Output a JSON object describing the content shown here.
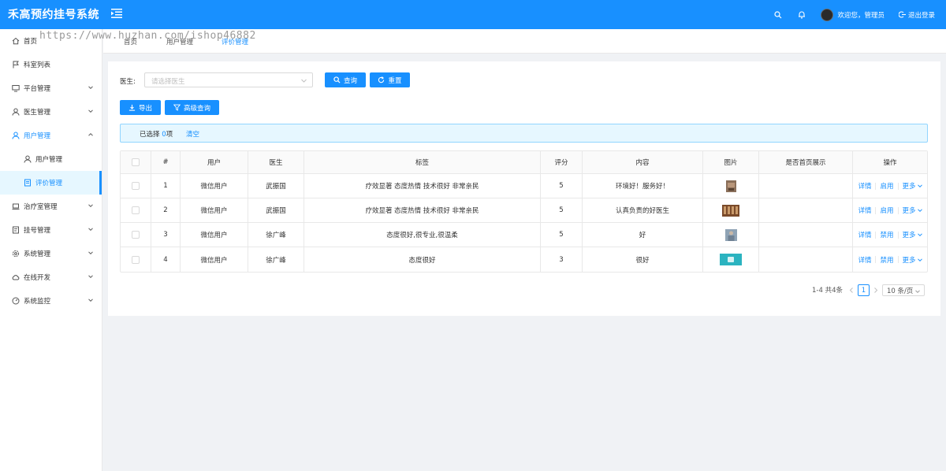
{
  "header": {
    "app_title": "禾高预约挂号系统",
    "welcome": "欢迎您，管理员",
    "logout": "退出登录"
  },
  "watermark": "https://www.huzhan.com/ishop46882",
  "sidebar": {
    "items": [
      {
        "label": "首页",
        "icon": "home-icon"
      },
      {
        "label": "科室列表",
        "icon": "flag-icon"
      },
      {
        "label": "平台管理",
        "icon": "monitor-icon"
      },
      {
        "label": "医生管理",
        "icon": "user-icon"
      },
      {
        "label": "用户管理",
        "icon": "user-icon"
      },
      {
        "label": "用户管理",
        "icon": "user-icon"
      },
      {
        "label": "评价管理",
        "icon": "document-icon"
      },
      {
        "label": "治疗室管理",
        "icon": "laptop-icon"
      },
      {
        "label": "挂号管理",
        "icon": "list-icon"
      },
      {
        "label": "系统管理",
        "icon": "gear-icon"
      },
      {
        "label": "在线开发",
        "icon": "cloud-icon"
      },
      {
        "label": "系统监控",
        "icon": "dashboard-icon"
      }
    ]
  },
  "tabs": [
    "首页",
    "用户管理",
    "评价管理"
  ],
  "filter": {
    "doctor_label": "医生:",
    "doctor_placeholder": "请选择医生",
    "query": "查询",
    "reset": "重置"
  },
  "toolbar": {
    "export": "导出",
    "advanced": "高级查询"
  },
  "selection": {
    "prefix": "已选择",
    "count": "0",
    "suffix": "项",
    "clear": "清空"
  },
  "table": {
    "columns": [
      "#",
      "用户",
      "医生",
      "标签",
      "评分",
      "内容",
      "图片",
      "是否首页展示",
      "操作"
    ],
    "rows": [
      {
        "no": "1",
        "user": "微信用户",
        "doctor": "武振国",
        "tags": "疗效显著 态度热情 技术很好 非常亲民",
        "score": "5",
        "content": "环境好！服务好！",
        "home": "",
        "op1": "详情",
        "op2": "启用",
        "op3": "更多",
        "img_color": "#8a6f5a"
      },
      {
        "no": "2",
        "user": "微信用户",
        "doctor": "武振国",
        "tags": "疗效显著 态度热情 技术很好 非常亲民",
        "score": "5",
        "content": "认真负责的好医生",
        "home": "",
        "op1": "详情",
        "op2": "启用",
        "op3": "更多",
        "img_color": "#7a4a2a"
      },
      {
        "no": "3",
        "user": "微信用户",
        "doctor": "徐广峰",
        "tags": "态度很好,很专业,很温柔",
        "score": "5",
        "content": "好",
        "home": "",
        "op1": "详情",
        "op2": "禁用",
        "op3": "更多",
        "img_color": "#8fa3b5"
      },
      {
        "no": "4",
        "user": "微信用户",
        "doctor": "徐广峰",
        "tags": "态度很好",
        "score": "3",
        "content": "很好",
        "home": "",
        "op1": "详情",
        "op2": "禁用",
        "op3": "更多",
        "img_color": "#2bb3c0"
      }
    ]
  },
  "pagination": {
    "range": "1-4 共4条",
    "current": "1",
    "page_size": "10 条/页"
  },
  "colors": {
    "primary": "#1890ff",
    "bg": "#f0f2f5"
  }
}
